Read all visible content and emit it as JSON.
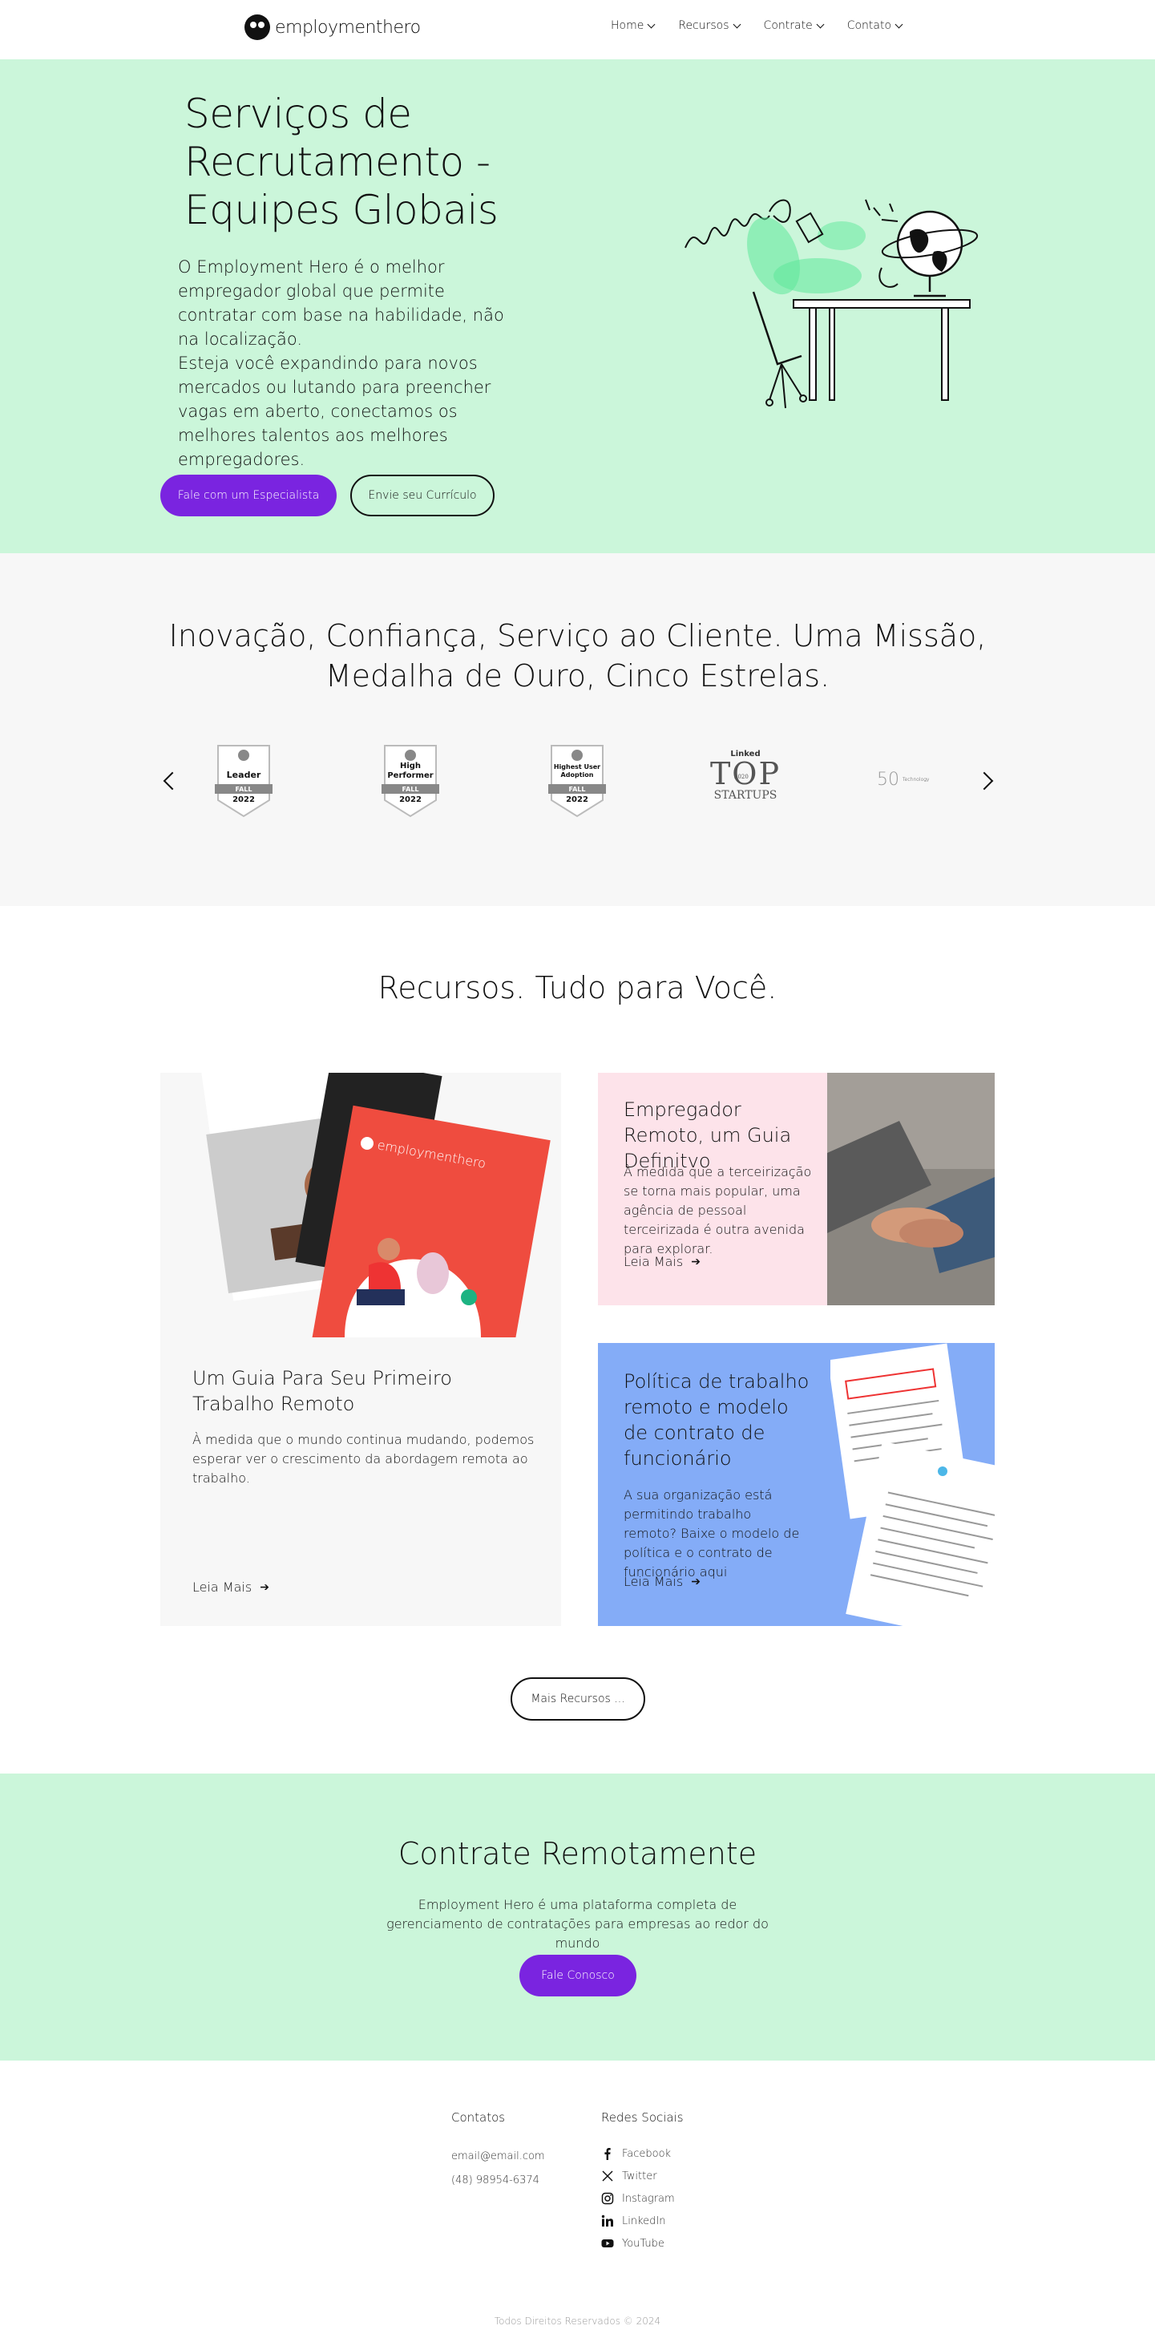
{
  "header": {
    "logo_text": "employmenthero",
    "nav": [
      {
        "label": "Home"
      },
      {
        "label": "Recursos"
      },
      {
        "label": "Contrate"
      },
      {
        "label": "Contato"
      }
    ]
  },
  "hero": {
    "title": "Serviços de Recrutamento - Equipes Globais",
    "paragraph1": "O Employment Hero é o melhor empregador global que permite contratar com base na habilidade, não na localização.",
    "paragraph2": "Esteja você expandindo para novos mercados ou lutando para preencher vagas em aberto, conectamos os melhores talentos aos melhores empregadores.",
    "primary_button": "Fale com um Especialista",
    "secondary_button": "Envie seu Currículo"
  },
  "awards": {
    "title": "Inovação, Confiança, Serviço ao Cliente. Uma Missão, Medalha de Ouro, Cinco Estrelas.",
    "badges": [
      {
        "name": "Leader",
        "season": "FALL",
        "year": "2022"
      },
      {
        "name": "High Performer",
        "season": "FALL",
        "year": "2022"
      },
      {
        "name": "Highest User Adoption",
        "season": "FALL",
        "year": "2022"
      }
    ],
    "linkedin_top": {
      "brand": "Linked",
      "title": "TOP",
      "year": "2020",
      "subtitle": "STARTUPS"
    },
    "fifty": {
      "number": "50",
      "text": "Technology"
    }
  },
  "resources": {
    "title": "Recursos. Tudo para Você.",
    "card_big": {
      "title": "Um Guia Para Seu Primeiro Trabalho Remoto",
      "text": "À medida que o mundo continua mudando, podemos esperar ver o crescimento da abordagem remota ao trabalho.",
      "link": "Leia Mais",
      "book_brand": "employmenthero"
    },
    "card_pink": {
      "title": "Empregador Remoto, um Guia Definitvo",
      "text": "À medida que a terceirização se torna mais popular, uma agência de pessoal terceirizada é outra avenida para explorar.",
      "link": "Leia Mais"
    },
    "card_blue": {
      "title": "Política de trabalho remoto e modelo de contrato de funcionário",
      "text": "A sua organização está permitindo trabalho remoto? Baixe o modelo de política e o contrato de funcionário aqui",
      "link": "Leia Mais"
    },
    "more_button": "Mais Recursos ..."
  },
  "hire": {
    "title": "Contrate Remotamente",
    "text": "Employment Hero é uma plataforma completa de gerenciamento de contratações para empresas ao redor do mundo",
    "button": "Fale Conosco"
  },
  "footer": {
    "contacts_heading": "Contatos",
    "email": "email@email.com",
    "phone": "(48) 98954-6374",
    "social_heading": "Redes Sociais",
    "social": [
      {
        "label": "Facebook",
        "icon": "facebook-icon"
      },
      {
        "label": "Twitter",
        "icon": "x-twitter-icon"
      },
      {
        "label": "Instagram",
        "icon": "instagram-icon"
      },
      {
        "label": "LinkedIn",
        "icon": "linkedin-icon"
      },
      {
        "label": "YouTube",
        "icon": "youtube-icon"
      }
    ],
    "copyright": "Todos Direitos Reservados © 2024"
  },
  "colors": {
    "mint": "#cbf6da",
    "purple": "#7a24e0",
    "pink": "#fde3ea",
    "blue": "#84acf7",
    "light_gray": "#f7f7f7"
  }
}
